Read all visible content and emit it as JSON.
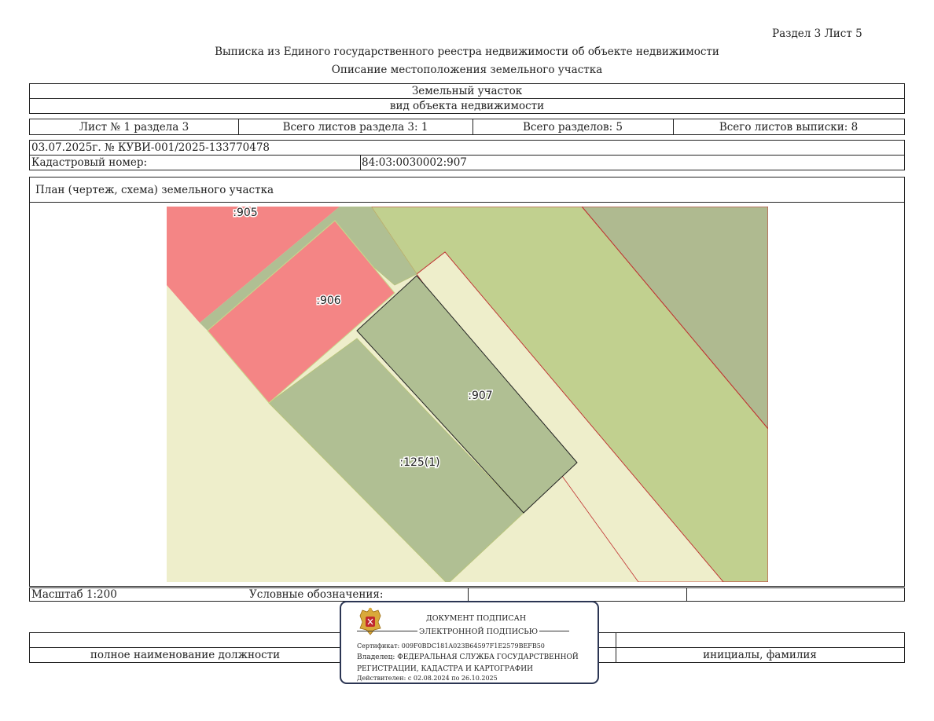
{
  "header": {
    "section_sheet": "Раздел 3   Лист 5",
    "title": "Выписка из Единого государственного реестра недвижимости об объекте недвижимости",
    "subtitle": "Описание местоположения земельного участка"
  },
  "object": {
    "type": "Земельный участок",
    "type_caption": "вид объекта недвижимости"
  },
  "sheets": {
    "sheet_no": "Лист № 1 раздела 3",
    "total_section_sheets": "Всего листов раздела 3: 1",
    "total_sections": "Всего разделов: 5",
    "total_extract_sheets": "Всего листов выписки: 8"
  },
  "record": {
    "date_number": "03.07.2025г. № КУВИ-001/2025-133770478",
    "cadastral_label": "Кадастровый номер:",
    "cadastral_value": "84:03:0030002:907"
  },
  "plan": {
    "title": "План (чертеж, схема) земельного участка",
    "labels": {
      "p905": ":905",
      "p906": ":906",
      "p907": ":907",
      "p125": ":125(1)"
    },
    "colors": {
      "background": "#eeeecb",
      "neighbor_pink": "#f48585",
      "zone_green": "#b0bf93",
      "zone_light_green": "#c1d08f",
      "zone_dark": "#afba90",
      "boundary_red": "#c03030"
    }
  },
  "legend": {
    "scale": "Масштаб 1:200",
    "legend_label": "Условные обозначения:"
  },
  "signature": {
    "position": "полное наименование должности",
    "name": "инициалы, фамилия"
  },
  "stamp": {
    "line1": "ДОКУМЕНТ ПОДПИСАН",
    "line2": "ЭЛЕКТРОННОЙ ПОДПИСЬЮ",
    "certificate": "Сертификат: 009F0BDC181A023B64597F1E2579BEFB50",
    "owner1": "Владелец: ФЕДЕРАЛЬНАЯ СЛУЖБА ГОСУДАРСТВЕННОЙ",
    "owner2": "РЕГИСТРАЦИИ, КАДАСТРА И КАРТОГРАФИИ",
    "validity": "Действителен: с 02.08.2024 по 26.10.2025",
    "emblem_icon": "russian-coat-of-arms-icon"
  }
}
